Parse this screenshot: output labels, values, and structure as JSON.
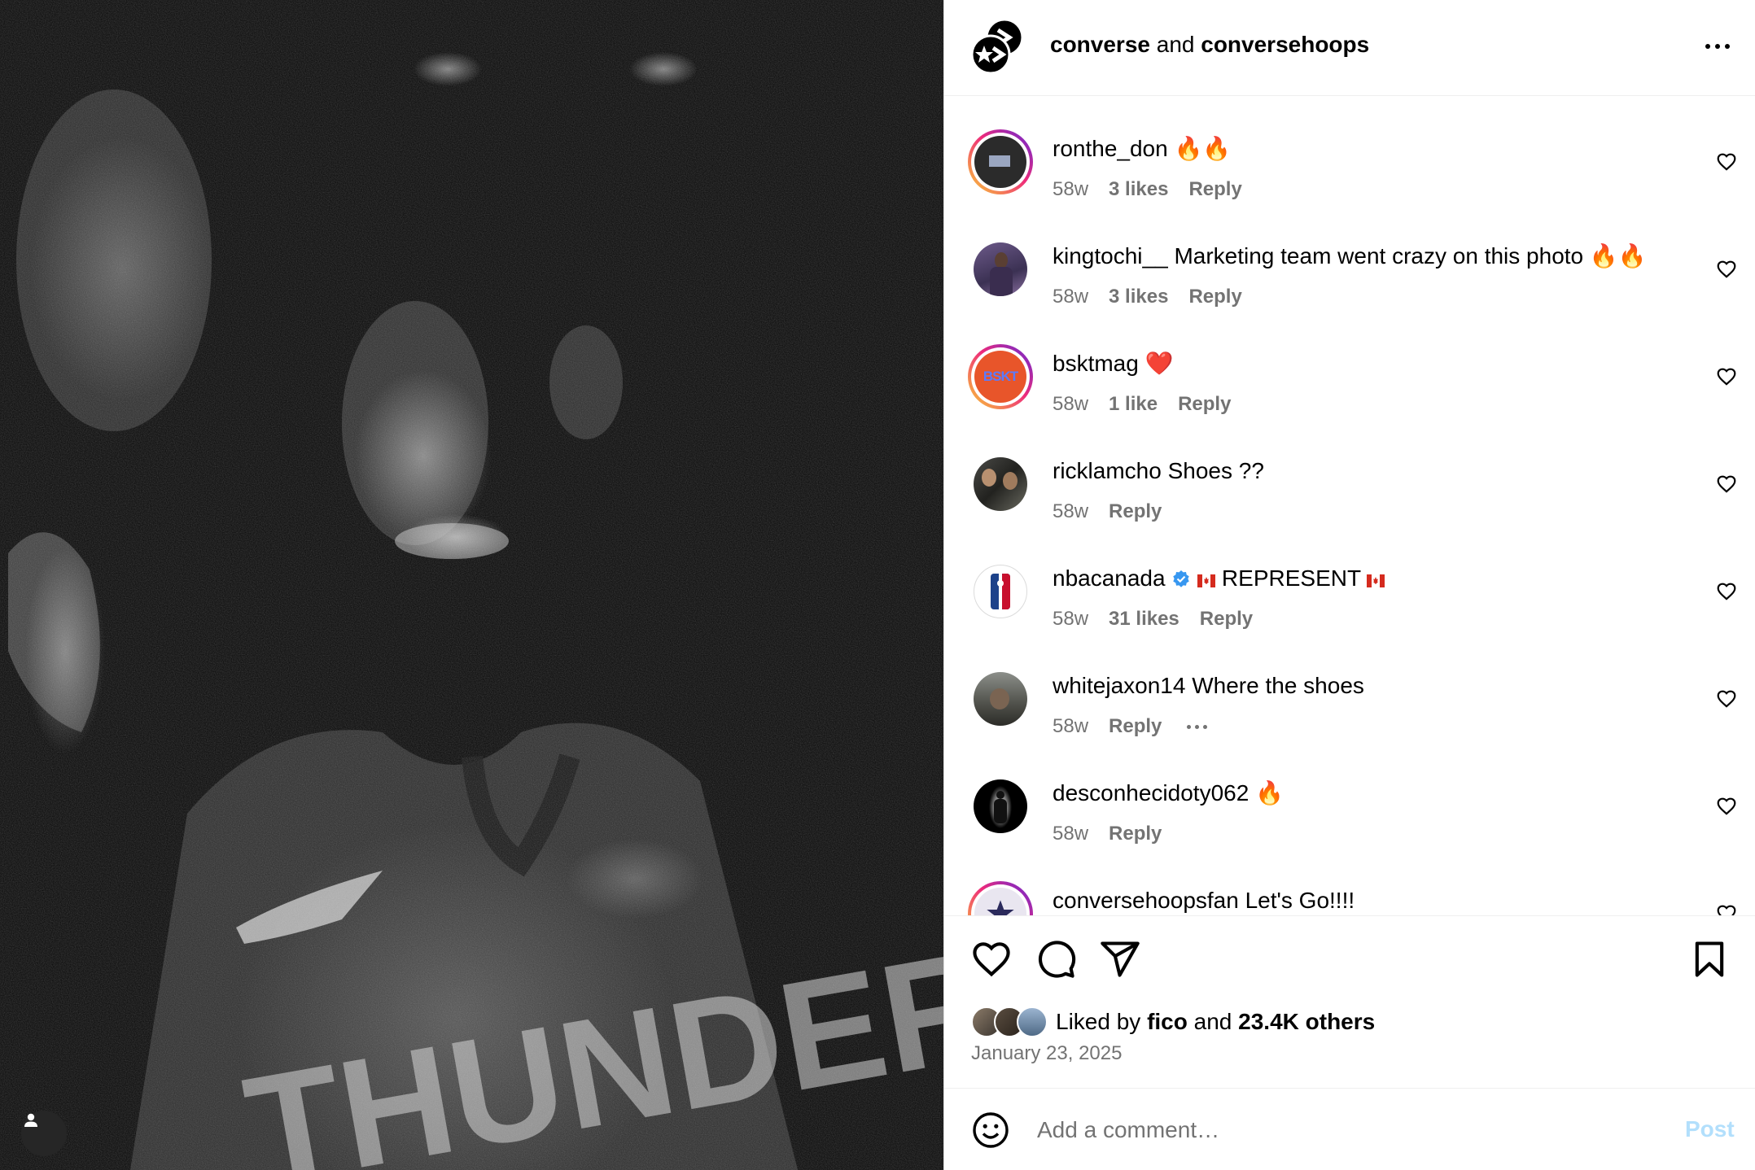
{
  "header": {
    "account_1": "converse",
    "joiner": "and",
    "account_2": "conversehoops"
  },
  "comments": [
    {
      "username": "ronthe_don",
      "text": "🔥🔥",
      "time": "58w",
      "likes": "3 likes",
      "reply": "Reply",
      "ring": true
    },
    {
      "username": "kingtochi__",
      "text": "Marketing team went crazy on this photo 🔥🔥",
      "time": "58w",
      "likes": "3 likes",
      "reply": "Reply",
      "ring": false
    },
    {
      "username": "bsktmag",
      "text": "❤️",
      "time": "58w",
      "likes": "1 like",
      "reply": "Reply",
      "ring": true
    },
    {
      "username": "ricklamcho",
      "text": "Shoes ??",
      "time": "58w",
      "likes": "",
      "reply": "Reply",
      "ring": false
    },
    {
      "username": "nbacanada",
      "text": "REPRESENT",
      "time": "58w",
      "likes": "31 likes",
      "reply": "Reply",
      "ring": false,
      "verified": true
    },
    {
      "username": "whitejaxon14",
      "text": "Where the shoes",
      "time": "58w",
      "likes": "",
      "reply": "Reply",
      "ring": false
    },
    {
      "username": "desconhecidoty062",
      "text": "🔥",
      "time": "58w",
      "likes": "",
      "reply": "Reply",
      "ring": false
    },
    {
      "username": "conversehoopsfan",
      "text": "Let's Go!!!!",
      "time": "",
      "likes": "",
      "reply": "",
      "ring": true
    }
  ],
  "avatar_labels": {
    "bsktmag": "BSKT"
  },
  "likes": {
    "prefix": "Liked by",
    "user": "fico",
    "joiner": "and",
    "others": "23.4K others"
  },
  "post_date": "January 23, 2025",
  "add_comment": {
    "placeholder": "Add a comment…",
    "post_label": "Post"
  },
  "colors": {
    "muted_text": "#737373",
    "post_button_disabled": "#b2dffc",
    "verified_blue": "#3797f0",
    "divider": "#efefef"
  },
  "icons": {
    "header_more": "more-horizontal-icon",
    "like": "heart-icon",
    "comment": "speech-bubble-icon",
    "share": "paper-plane-icon",
    "save": "bookmark-icon",
    "emoji": "smiley-icon",
    "photo_user": "person-icon"
  }
}
